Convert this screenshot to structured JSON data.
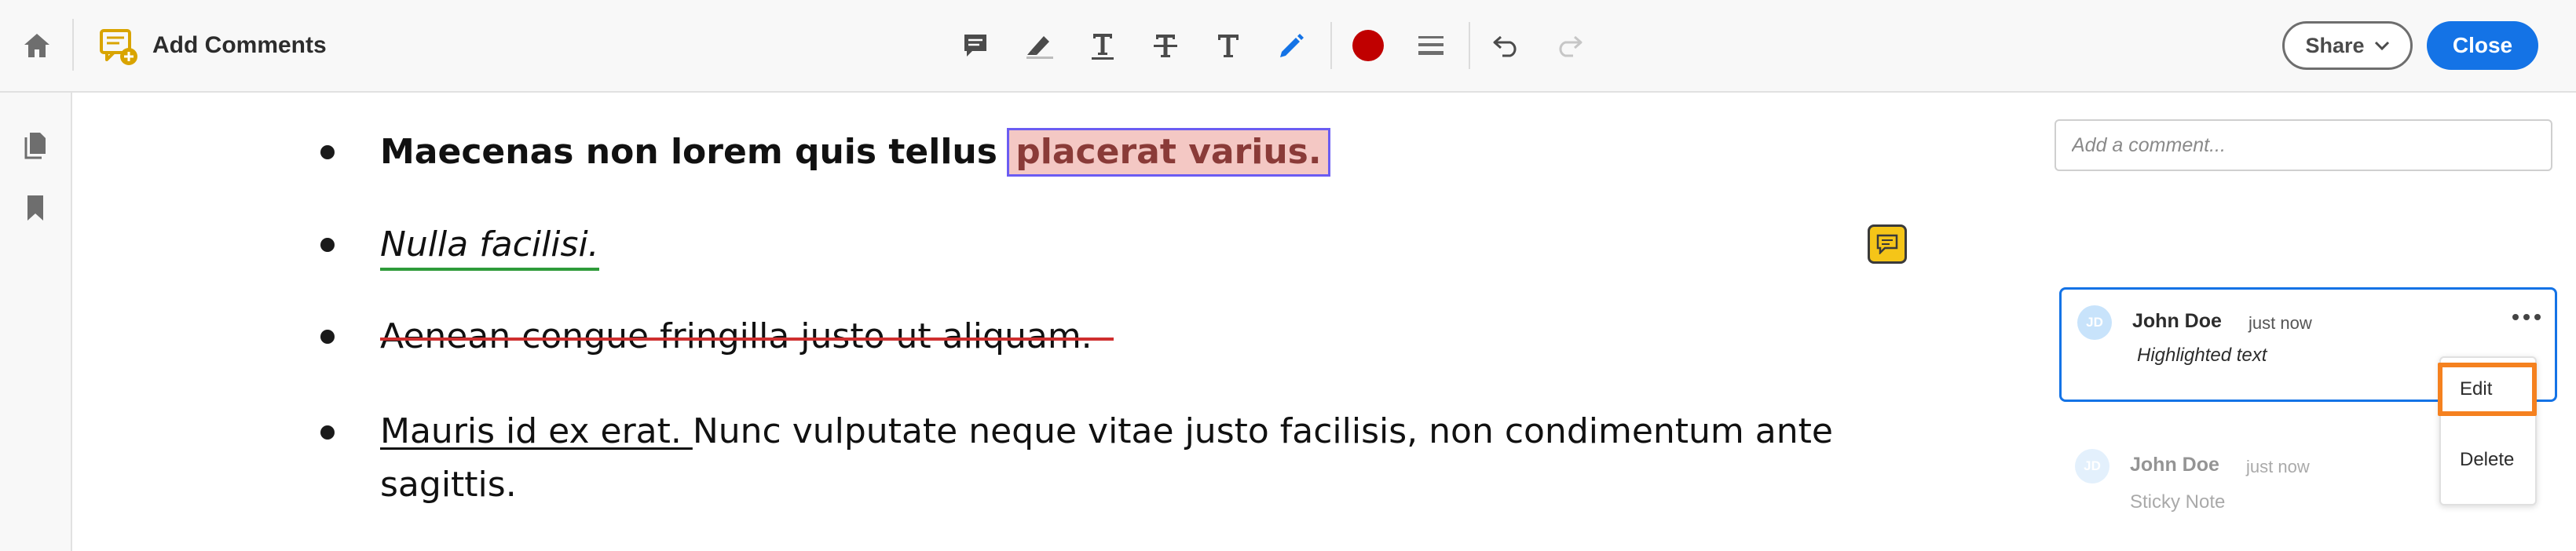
{
  "app": {
    "tool_title": "Add Comments",
    "icons": {
      "home": "home-icon",
      "tool": "add-comment-icon",
      "files": "pages-icon",
      "bookmark": "bookmark-icon"
    }
  },
  "toolbar": {
    "tools": [
      {
        "name": "sticky-note-tool",
        "icon": "sticky-note-icon"
      },
      {
        "name": "highlight-tool",
        "icon": "highlighter-icon"
      },
      {
        "name": "underline-text-tool",
        "icon": "underline-t-icon"
      },
      {
        "name": "strikethrough-tool",
        "icon": "strikethrough-t-icon"
      },
      {
        "name": "add-text-tool",
        "icon": "text-t-icon"
      },
      {
        "name": "draw-tool",
        "icon": "pencil-icon"
      },
      {
        "name": "color-picker",
        "icon": "color-swatch-icon"
      },
      {
        "name": "stroke-thickness-tool",
        "icon": "line-weight-icon"
      },
      {
        "name": "undo-button",
        "icon": "undo-icon"
      },
      {
        "name": "redo-button",
        "icon": "redo-icon"
      }
    ],
    "selected_color": "#c00000",
    "share_label": "Share",
    "close_label": "Close"
  },
  "document": {
    "line1_plain": "Maecenas non lorem quis tellus ",
    "line1_highlight": "placerat varius.",
    "line2": "Nulla facilisi.",
    "line3": "Aenean congue fringilla justo ut aliquam.",
    "line4_underlined": "Mauris id ex erat. ",
    "line4_rest": "Nunc vulputate neque vitae justo facilisis, non condimentum ante",
    "line5": "sagittis."
  },
  "comments_panel": {
    "input_placeholder": "Add a comment...",
    "comments": [
      {
        "initials": "JD",
        "author": "John Doe",
        "time": "just now",
        "body": "Highlighted text"
      },
      {
        "initials": "JD",
        "author": "John Doe",
        "time": "just now",
        "body": "Sticky Note"
      }
    ],
    "menu": {
      "edit": "Edit",
      "delete": "Delete"
    }
  },
  "colors": {
    "accent": "#1473e6",
    "highlight_bg": "#f4c8c4",
    "underline_green": "#2e9b3a",
    "strike_red": "#cf2e2e",
    "focus_orange": "#f5811f",
    "sticky_yellow": "#f5c518"
  }
}
